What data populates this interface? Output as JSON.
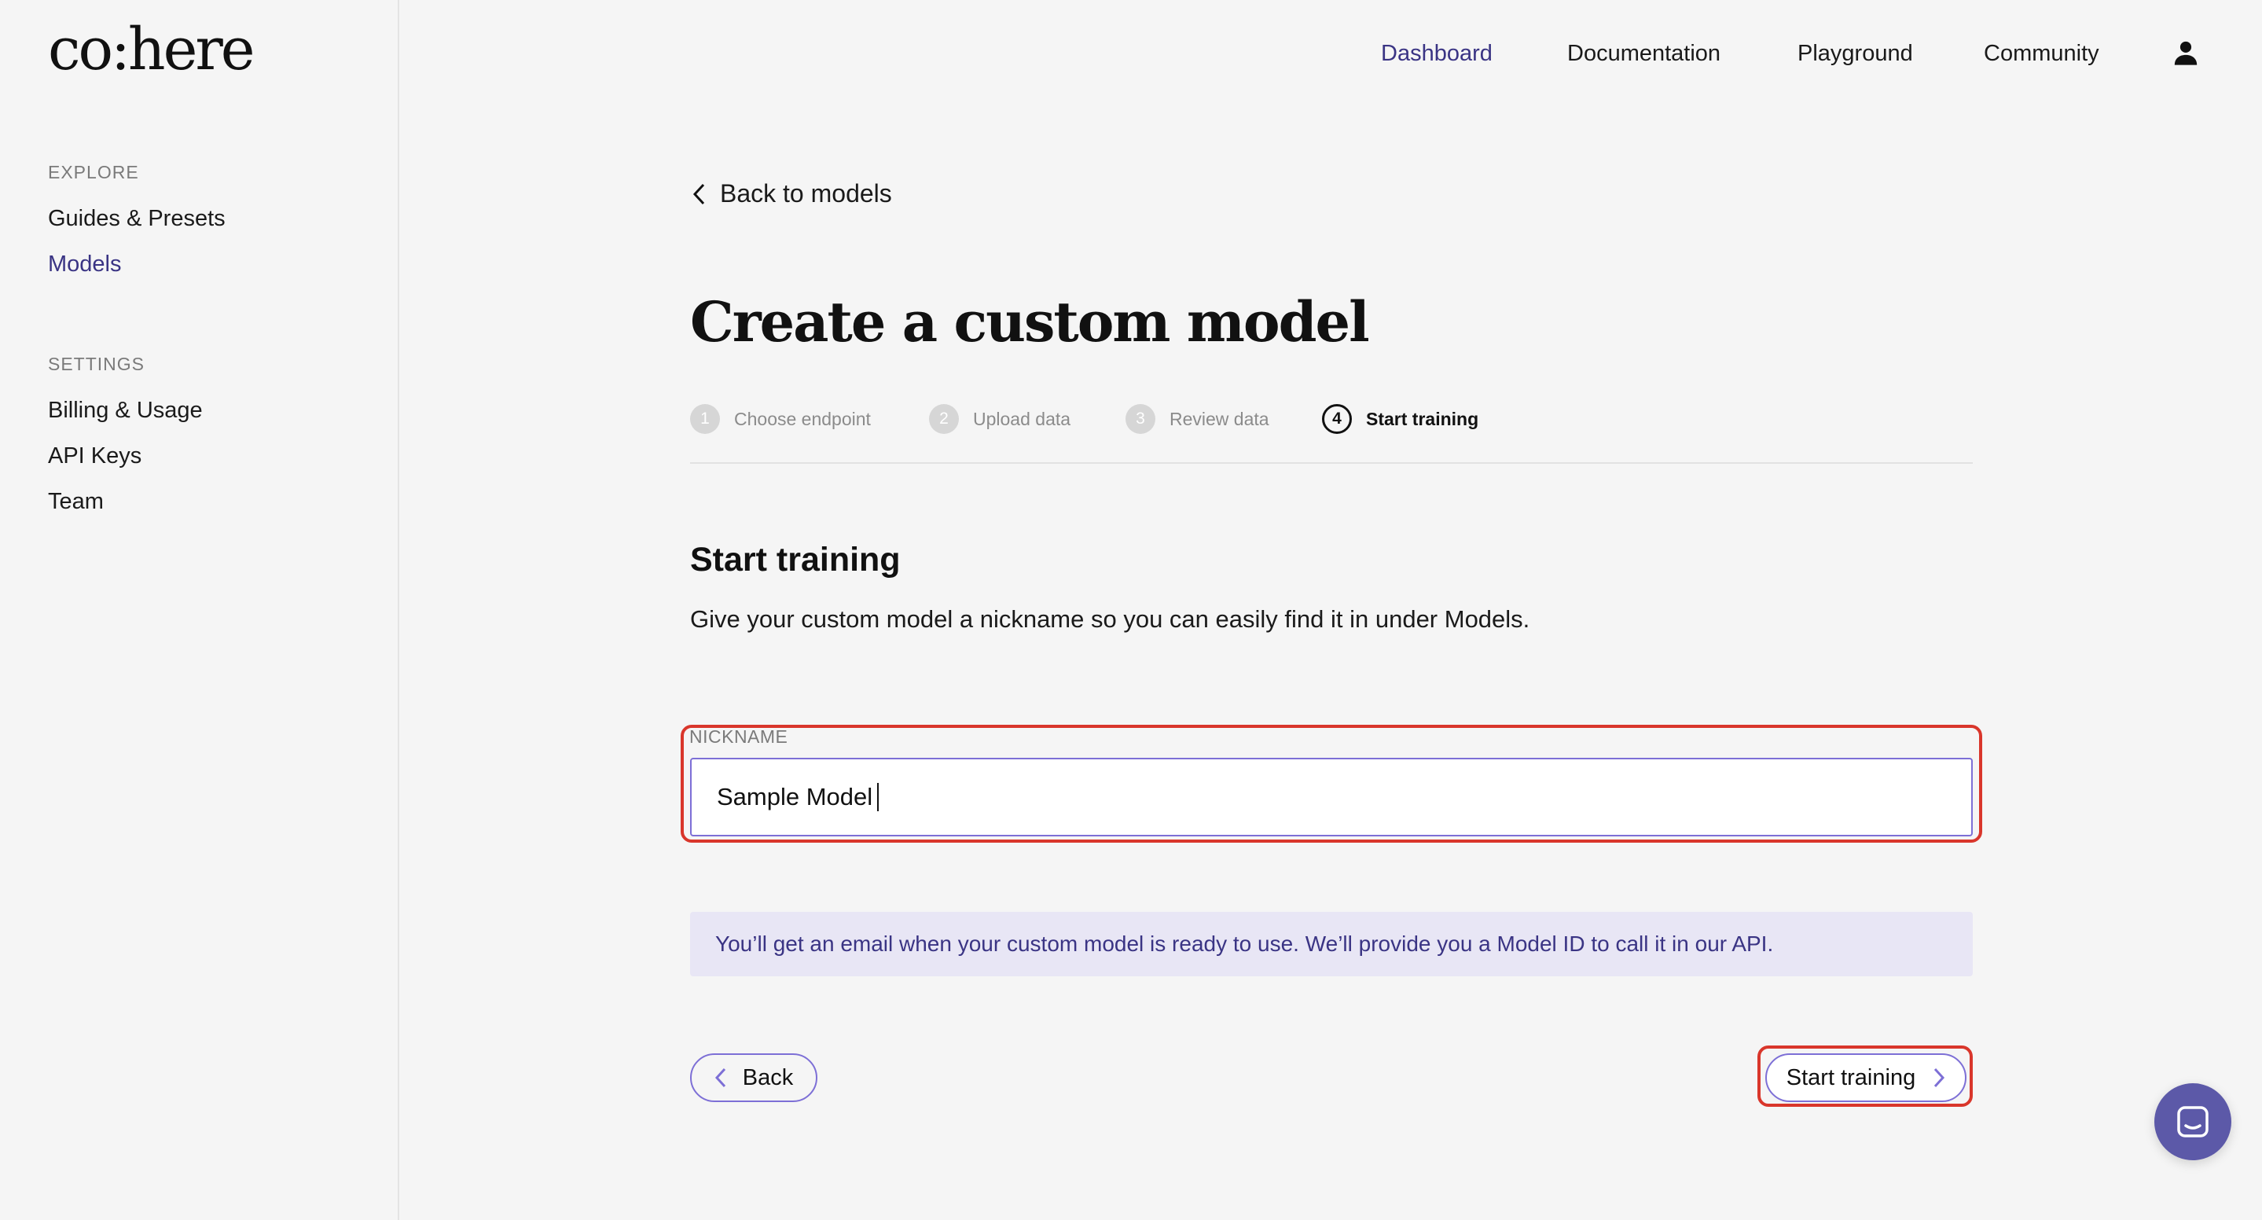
{
  "brand": {
    "logo_text": "co:here"
  },
  "sidebar": {
    "explore_label": "EXPLORE",
    "explore_items": [
      {
        "label": "Guides & Presets"
      },
      {
        "label": "Models"
      }
    ],
    "settings_label": "SETTINGS",
    "settings_items": [
      {
        "label": "Billing & Usage"
      },
      {
        "label": "API Keys"
      },
      {
        "label": "Team"
      }
    ]
  },
  "topnav": {
    "items": [
      {
        "label": "Dashboard"
      },
      {
        "label": "Documentation"
      },
      {
        "label": "Playground"
      },
      {
        "label": "Community"
      }
    ]
  },
  "main": {
    "back_link": "Back to models",
    "title": "Create a custom model",
    "steps": [
      {
        "num": "1",
        "label": "Choose endpoint"
      },
      {
        "num": "2",
        "label": "Upload data"
      },
      {
        "num": "3",
        "label": "Review data"
      },
      {
        "num": "4",
        "label": "Start training"
      }
    ],
    "section_title": "Start training",
    "section_desc": "Give your custom model a nickname so you can easily find it in under Models.",
    "nickname": {
      "label": "NICKNAME",
      "value": "Sample Model"
    },
    "info": "You’ll get an email when your custom model is ready to use. We’ll provide you a Model ID to call it in our API.",
    "back_button": "Back",
    "start_button": "Start training"
  },
  "colors": {
    "accent": "#3a3484",
    "highlight": "#d9362b",
    "info_bg": "#e8e6f5",
    "fab": "#5c59a8"
  }
}
